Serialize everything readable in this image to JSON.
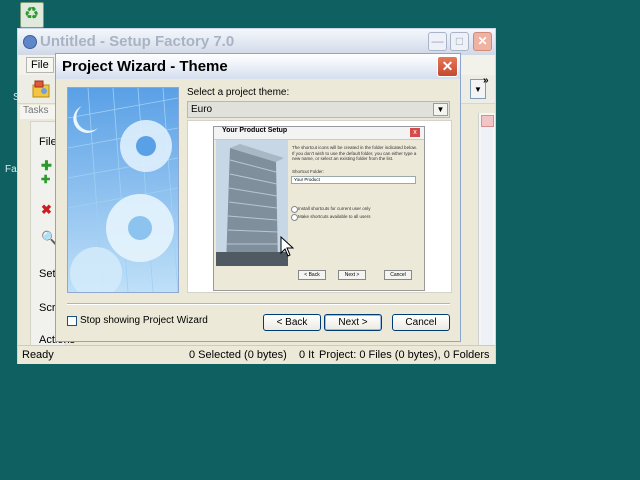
{
  "desktop": {
    "fragments": [
      "S",
      "Fa"
    ]
  },
  "main_window": {
    "title": "Untitled - Setup Factory 7.0",
    "caption_buttons": {
      "minimize": "—",
      "maximize": "□",
      "close": "✕"
    },
    "menu": {
      "file": "File"
    },
    "toolbar": {
      "dropdown_arrow": "▼",
      "overflow": "»"
    },
    "tasks_header": "Tasks",
    "task_pane": {
      "file_section": "File",
      "sections": [
        "Set",
        "Scr",
        "Actions"
      ]
    },
    "statusbar": {
      "ready": "Ready",
      "selected": "0 Selected (0 bytes)",
      "items": "0 It",
      "project": "Project: 0 Files (0 bytes), 0 Folders"
    }
  },
  "wizard": {
    "title": "Project Wizard - Theme",
    "close": "✕",
    "select_label": "Select a project theme:",
    "theme_value": "Euro",
    "dropdown_arrow": "▼",
    "preview": {
      "title": "Your Product Setup",
      "body_text": "The shortcut icons will be created in the folder indicated below. If you don't wish to use the default folder, you can either type a new name, or select an existing folder from the list.",
      "folder_label": "Shortcut Folder:",
      "folder_value": "Your Product",
      "radio_1": "Install shortcuts for current user only",
      "radio_2": "Make shortcuts available to all users",
      "back": "< Back",
      "next": "Next >",
      "cancel": "Cancel"
    },
    "stop_label": "Stop showing Project Wizard",
    "stop_checked": false,
    "back_label": "< Back",
    "next_label": "Next >",
    "cancel_label": "Cancel"
  }
}
